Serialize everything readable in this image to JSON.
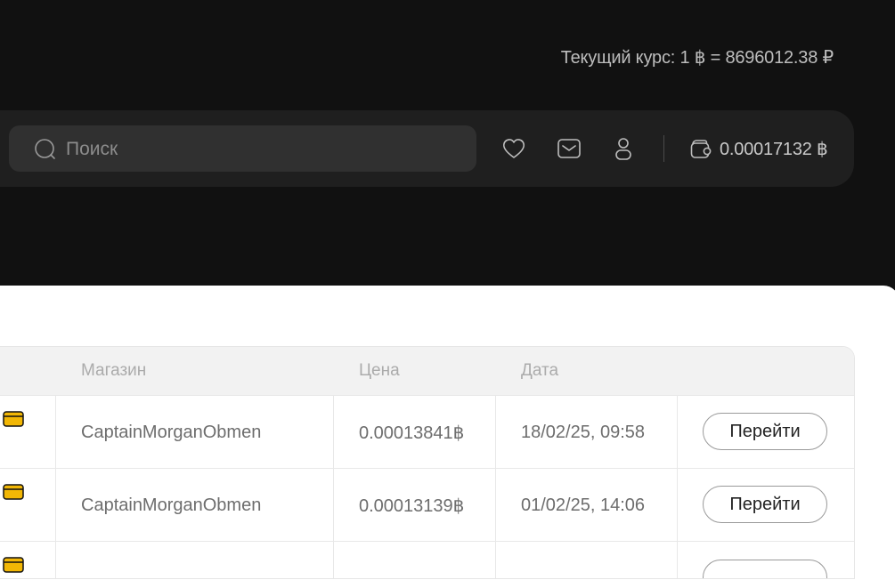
{
  "header": {
    "rate_text": "Текущий курс: 1 ฿ = 8696012.38 ₽"
  },
  "toolbar": {
    "search_placeholder": "Поиск",
    "balance": "0.00017132 ฿",
    "icons": [
      "search-icon",
      "heart-icon",
      "mail-icon",
      "user-icon",
      "wallet-icon"
    ]
  },
  "table": {
    "columns": [
      "Магазин",
      "Цена",
      "Дата"
    ],
    "rows": [
      {
        "shop": "CaptainMorganObmen",
        "price": "0.00013841฿",
        "date": "18/02/25, 09:58",
        "action": "Перейти"
      },
      {
        "shop": "CaptainMorganObmen",
        "price": "0.00013139฿",
        "date": "01/02/25, 14:06",
        "action": "Перейти"
      }
    ]
  },
  "colors": {
    "background": "#111111",
    "toolbar": "#1f1f1f",
    "search_field": "#303030",
    "card_icon": "#f2b705"
  }
}
